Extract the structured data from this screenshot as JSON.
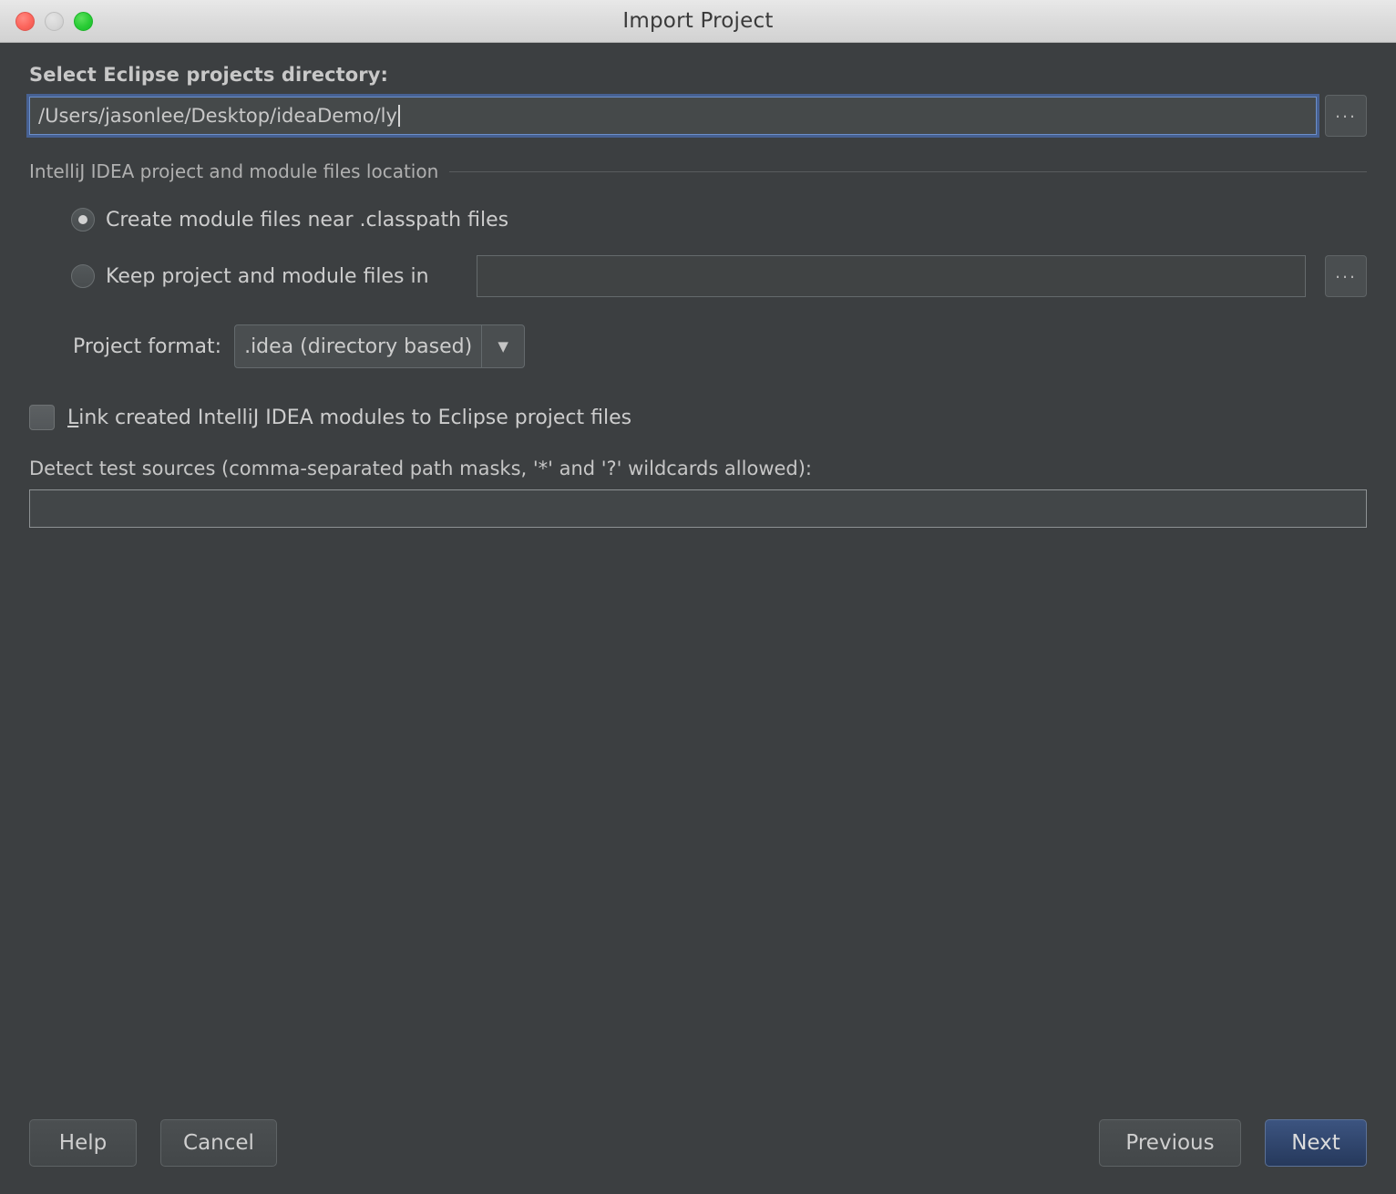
{
  "window": {
    "title": "Import Project",
    "traffic_lights": [
      "close-button",
      "minimize-button",
      "maximize-button"
    ]
  },
  "form": {
    "directory_label": "Select Eclipse projects directory:",
    "directory_value": "/Users/jasonlee/Desktop/ideaDemo/ly",
    "directory_browse_label": "...",
    "group_label": "IntelliJ IDEA project and module files location",
    "radio_create_label": "Create module files near .classpath files",
    "radio_keep_label": "Keep project and module files in",
    "keep_path_value": "",
    "keep_browse_label": "...",
    "format_label": "Project format:",
    "format_value": ".idea (directory based)",
    "format_arrow": "▼",
    "format_options": [
      ".idea (directory based)"
    ],
    "link_checkbox_mnemonic": "L",
    "link_checkbox_label": "ink created IntelliJ IDEA modules to Eclipse project files",
    "detect_label": "Detect test sources (comma-separated path masks, '*' and '?' wildcards allowed):",
    "detect_value": ""
  },
  "footer": {
    "help_label": "Help",
    "cancel_label": "Cancel",
    "previous_label": "Previous",
    "next_label": "Next"
  },
  "colors": {
    "background": "#3c3f41",
    "titlebar": "#dcdcdc",
    "accent_focus": "#4b6eaf",
    "default_button": "#3c5480",
    "text": "#cdcdcd",
    "close": "#fc655c",
    "minimize": "#d6d6d6",
    "maximize": "#29cc35"
  }
}
